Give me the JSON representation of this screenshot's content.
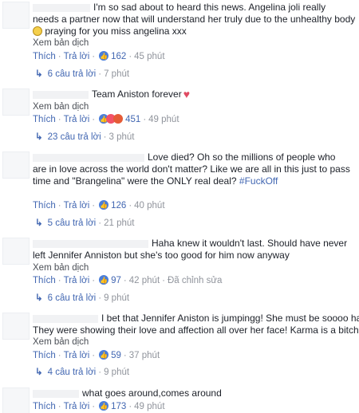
{
  "comments": [
    {
      "text_line1": "I'm so sad about to heard this news. Angelina joli really",
      "text_line2": "needs a partner now that will understand her truly due to the unhealthy body",
      "text_line3": "praying for you miss angelina xxx",
      "translate": "Xem bản dịch",
      "like": "Thích",
      "reply": "Trả lời",
      "reaction_count": "162",
      "time": "45 phút",
      "replies_text": "6 câu trả lời",
      "replies_time": "7 phút"
    },
    {
      "text_line1": "Team Aniston forever",
      "translate": "Xem bản dịch",
      "like": "Thích",
      "reply": "Trả lời",
      "reaction_count": "451",
      "time": "49 phút",
      "replies_text": "23 câu trả lời",
      "replies_time": "3 phút"
    },
    {
      "text_line1": "Love died? Oh so the millions of people who",
      "text_line2": "are in love across the world don't matter? Like we are all in this just to pass",
      "text_line3": "time and \"Brangelina\" were the ONLY real deal?",
      "hashtag": "#FuckOff",
      "like": "Thích",
      "reply": "Trả lời",
      "reaction_count": "126",
      "time": "40 phút",
      "replies_text": "5 câu trả lời",
      "replies_time": "21 phút"
    },
    {
      "text_line1": "Haha knew it wouldn't last. Should have never",
      "text_line2": "left Jennifer Anniston but she's too good for him now anyway",
      "translate": "Xem bản dịch",
      "like": "Thích",
      "reply": "Trả lời",
      "reaction_count": "97",
      "time": "42 phút",
      "edited": "Đã chỉnh sửa",
      "replies_text": "6 câu trả lời",
      "replies_time": "9 phút"
    },
    {
      "text_line1": "I bet that Jennifer Aniston is jumpingg! She must be soooo happy!",
      "text_line2": "They were showing their love and affection all over her face! Karma is a bitch!",
      "translate": "Xem bản dịch",
      "like": "Thích",
      "reply": "Trả lời",
      "reaction_count": "59",
      "time": "37 phút",
      "replies_text": "4 câu trả lời",
      "replies_time": "9 phút"
    },
    {
      "text_line1": "what goes around,comes around",
      "like": "Thích",
      "reply": "Trả lời",
      "reaction_count": "173",
      "time": "49 phút"
    }
  ],
  "colors": {
    "link": "#4267b2",
    "meta": "#90949c",
    "text": "#1d2129",
    "like_reaction": "#4a7dd9",
    "love_reaction": "#f25268"
  }
}
